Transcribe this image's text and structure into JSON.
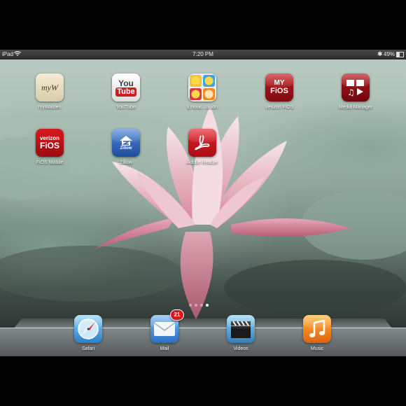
{
  "status_bar": {
    "carrier": "iPad",
    "time": "7:20 PM",
    "battery_percent": "49%",
    "battery_level": 0.49
  },
  "apps": [
    {
      "label": "myWalden",
      "icon_text": "myW"
    },
    {
      "label": "YouTube",
      "icon_text_top": "You",
      "icon_text_bottom": "Tube"
    },
    {
      "label": "Emotic...dition"
    },
    {
      "label": "Verizon FiOS",
      "icon_text_top": "MY",
      "icon_text_bottom": "FiOS"
    },
    {
      "label": "Media Manager"
    },
    {
      "label": "FiOS Mobile",
      "icon_text_top": "verizon",
      "icon_text_bottom": "FiOS"
    },
    {
      "label": "Zillow",
      "icon_text": "Zillow"
    },
    {
      "label": "Adobe Reader"
    }
  ],
  "page_dots": {
    "count": 4,
    "active_index": 3
  },
  "dock": [
    {
      "label": "Safari",
      "icon": "compass-icon"
    },
    {
      "label": "Mail",
      "icon": "envelope-icon",
      "badge": "21"
    },
    {
      "label": "Videos",
      "icon": "clapperboard-icon"
    },
    {
      "label": "Music",
      "icon": "music-note-icon"
    }
  ]
}
